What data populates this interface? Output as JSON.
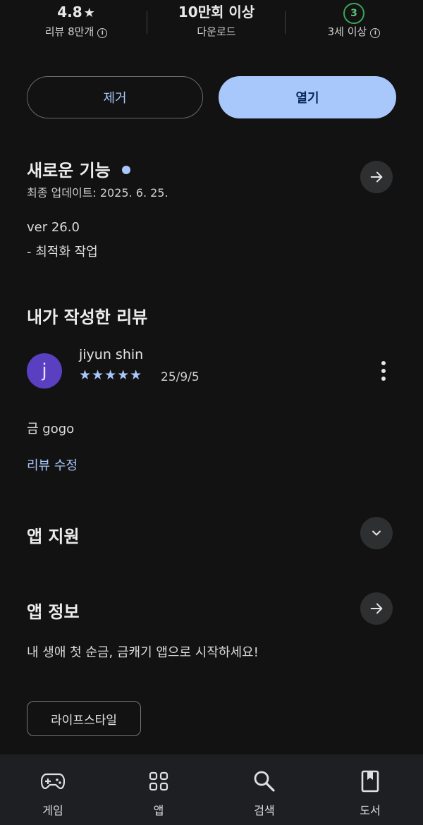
{
  "stats": {
    "rating": {
      "value": "4.8",
      "star": "★",
      "label": "리뷰 8만개"
    },
    "downloads": {
      "value": "10만회 이상",
      "label": "다운로드"
    },
    "age": {
      "value": "3",
      "label": "3세 이상",
      "badge_color": "#3aa65a"
    }
  },
  "actions": {
    "uninstall_label": "제거",
    "open_label": "열기"
  },
  "whats_new": {
    "title": "새로운 기능",
    "updated": "최종 업데이트: 2025. 6. 25.",
    "version": "ver 26.0",
    "note": "- 최적화 작업"
  },
  "my_review": {
    "title": "내가 작성한 리뷰",
    "avatar_letter": "j",
    "author": "jiyun shin",
    "stars": 5,
    "stars_text": "★★★★★",
    "date": "25/9/5",
    "text": "금 gogo",
    "edit_label": "리뷰 수정"
  },
  "app_support": {
    "title": "앱 지원"
  },
  "app_info": {
    "title": "앱 정보",
    "description": "내 생애 첫 순금, 금캐기 앱으로 시작하세요!",
    "category": "라이프스타일"
  },
  "bottom_nav": [
    {
      "label": "게임",
      "icon": "gamepad-icon"
    },
    {
      "label": "앱",
      "icon": "apps-grid-icon"
    },
    {
      "label": "검색",
      "icon": "search-icon"
    },
    {
      "label": "도서",
      "icon": "book-icon"
    }
  ],
  "colors": {
    "accent": "#a8c7fa",
    "background": "#121212",
    "avatar": "#5b3fc1"
  }
}
